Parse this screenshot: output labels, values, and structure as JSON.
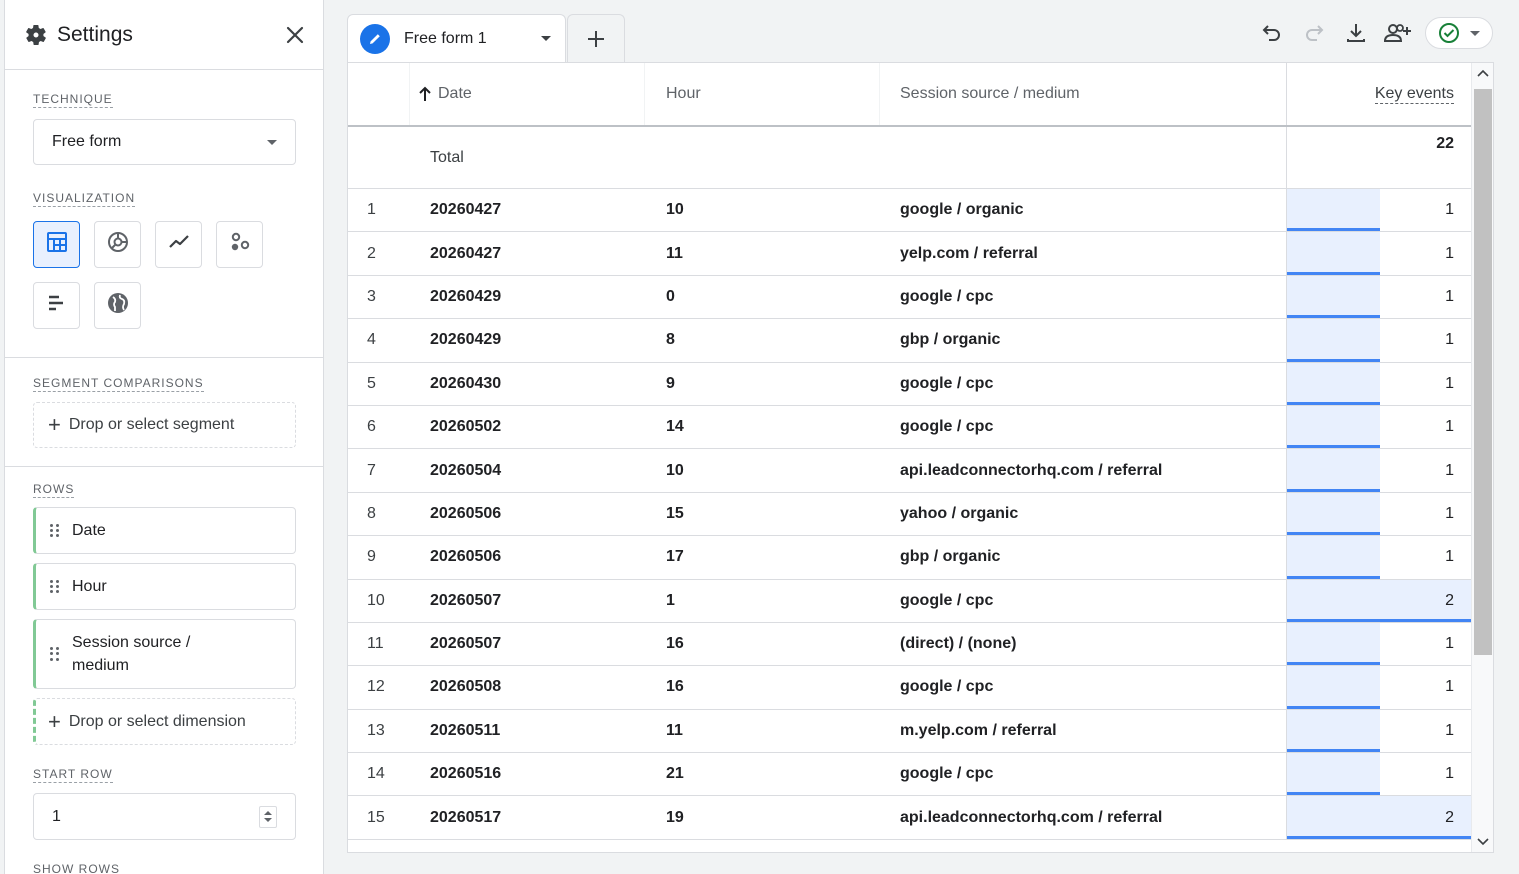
{
  "settings": {
    "title": "Settings",
    "technique_label": "TECHNIQUE",
    "technique_value": "Free form",
    "visualization_label": "VISUALIZATION",
    "segment_label": "SEGMENT COMPARISONS",
    "segment_drop": "Drop or select segment",
    "rows_label": "ROWS",
    "rows": [
      "Date",
      "Hour",
      "Session source / medium"
    ],
    "dimension_drop": "Drop or select dimension",
    "start_row_label": "START ROW",
    "start_row_value": "1",
    "show_rows_label": "SHOW ROWS"
  },
  "tab": {
    "label": "Free form 1"
  },
  "table": {
    "headers": {
      "date": "Date",
      "hour": "Hour",
      "source": "Session source / medium",
      "key_events": "Key events"
    },
    "total_label": "Total",
    "total_value": "22",
    "rows": [
      {
        "idx": "1",
        "date": "20260427",
        "hour": "10",
        "source": "google / organic",
        "ke": 1
      },
      {
        "idx": "2",
        "date": "20260427",
        "hour": "11",
        "source": "yelp.com / referral",
        "ke": 1
      },
      {
        "idx": "3",
        "date": "20260429",
        "hour": "0",
        "source": "google / cpc",
        "ke": 1
      },
      {
        "idx": "4",
        "date": "20260429",
        "hour": "8",
        "source": "gbp / organic",
        "ke": 1
      },
      {
        "idx": "5",
        "date": "20260430",
        "hour": "9",
        "source": "google / cpc",
        "ke": 1
      },
      {
        "idx": "6",
        "date": "20260502",
        "hour": "14",
        "source": "google / cpc",
        "ke": 1
      },
      {
        "idx": "7",
        "date": "20260504",
        "hour": "10",
        "source": "api.leadconnectorhq.com / referral",
        "ke": 1
      },
      {
        "idx": "8",
        "date": "20260506",
        "hour": "15",
        "source": "yahoo / organic",
        "ke": 1
      },
      {
        "idx": "9",
        "date": "20260506",
        "hour": "17",
        "source": "gbp / organic",
        "ke": 1
      },
      {
        "idx": "10",
        "date": "20260507",
        "hour": "1",
        "source": "google / cpc",
        "ke": 2
      },
      {
        "idx": "11",
        "date": "20260507",
        "hour": "16",
        "source": "(direct) / (none)",
        "ke": 1
      },
      {
        "idx": "12",
        "date": "20260508",
        "hour": "16",
        "source": "google / cpc",
        "ke": 1
      },
      {
        "idx": "13",
        "date": "20260511",
        "hour": "11",
        "source": "m.yelp.com / referral",
        "ke": 1
      },
      {
        "idx": "14",
        "date": "20260516",
        "hour": "21",
        "source": "google / cpc",
        "ke": 1
      },
      {
        "idx": "15",
        "date": "20260517",
        "hour": "19",
        "source": "api.leadconnectorhq.com / referral",
        "ke": 2
      }
    ],
    "ke_max": 2
  },
  "colors": {
    "accent": "#1a73e8",
    "bar_fill": "#e8f0fe",
    "bar_line": "#4285f4",
    "row_chip": "#81c995",
    "status_ok": "#188038"
  }
}
